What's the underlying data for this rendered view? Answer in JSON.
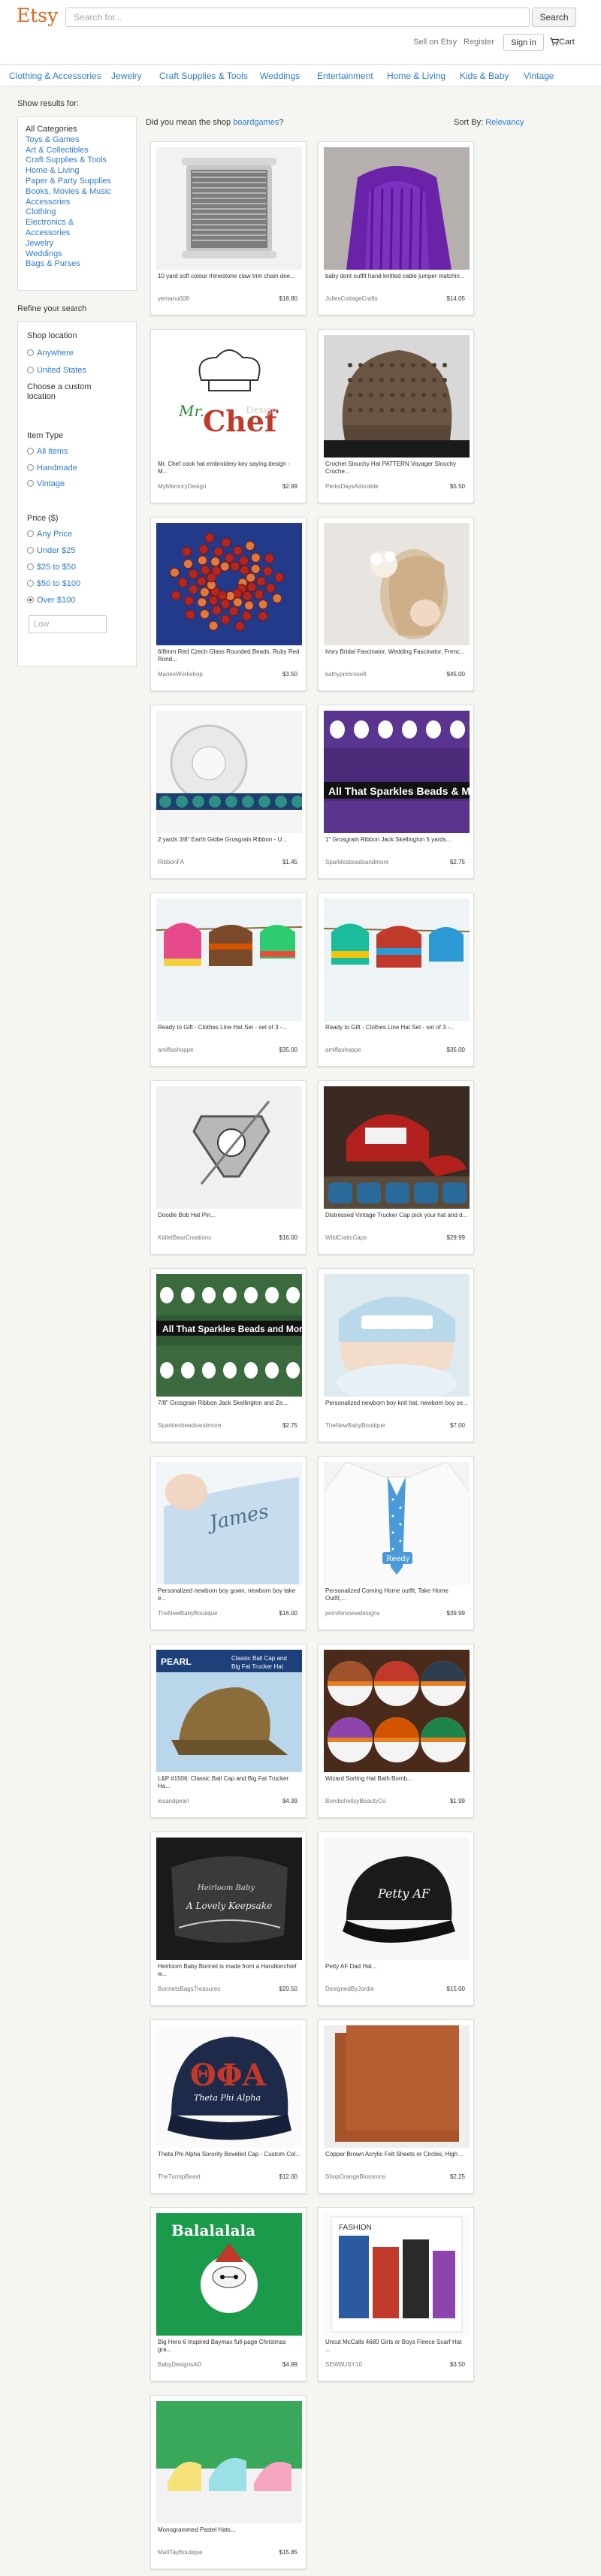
{
  "header": {
    "logo": "Etsy",
    "search_placeholder": "Search for...",
    "search_button": "Search",
    "sell": "Sell on Etsy",
    "register": "Register",
    "signin": "Sign in",
    "cart": "Cart"
  },
  "categories": [
    "Clothing & Accessories",
    "Jewelry",
    "Craft Supplies & Tools",
    "Weddings",
    "Entertainment",
    "Home & Living",
    "Kids & Baby",
    "Vintage"
  ],
  "sidebar": {
    "show_results": "Show results for:",
    "all_categories": "All Categories",
    "category_links": [
      "Toys & Games",
      "Art & Collectibles",
      "Craft Supplies & Tools",
      "Home & Living",
      "Paper & Party Supplies",
      "Books, Movies & Music",
      "Accessories",
      "Clothing",
      "Electronics &",
      "Accessories",
      "Jewelry",
      "Weddings",
      "Bags & Purses"
    ],
    "refine": "Refine your search",
    "shop_location": "Shop location",
    "location_options": [
      "Anywhere",
      "United States"
    ],
    "custom_location": "Choose a custom location",
    "item_type": "Item Type",
    "item_type_options": [
      "All items",
      "Handmade",
      "Vintage"
    ],
    "price": "Price ($)",
    "price_options": [
      "Any Price",
      "Under $25",
      "$25 to $50",
      "$50 to $100",
      "Over $100"
    ],
    "price_selected": "Over $100",
    "low_placeholder": "Low"
  },
  "main": {
    "did_you_mean_prefix": "Did you mean the shop",
    "did_you_mean_link": "boardgames",
    "did_you_mean_suffix": "?",
    "sort_label": "Sort By:",
    "sort_value": "Relevancy"
  },
  "listings": [
    {
      "title": "10 yard soft colour rhinestone claw trim chain dee...",
      "shop": "yemanu008",
      "price": "$18.80",
      "image": "rhinestone-chain-spool",
      "color": "#9a9a9a"
    },
    {
      "title": "baby dont outfit hand knitted cable jumper matchin...",
      "shop": "JuliesCottageCrafts",
      "price": "$14.05",
      "image": "purple-knit-sweater",
      "color": "#6a22a8"
    },
    {
      "title": "Mr. Chef cook hat embroidery key saying design - M...",
      "shop": "MyMemoryDesign",
      "price": "$2.99",
      "image": "chef-hat-embroidery",
      "color": "#c0392b"
    },
    {
      "title": "Crochet Slouchy Hat PATTERN Voyager Slouchy Croche...",
      "shop": "PerksDaysAdorable",
      "price": "$5.50",
      "image": "brown-slouchy-hat",
      "color": "#6b5643"
    },
    {
      "title": "6/8mm Red Czech Glass Rounded Beads, Ruby Red Rond...",
      "shop": "MariesWorkshop",
      "price": "$3.50",
      "image": "red-glass-beads",
      "color": "#b4261e"
    },
    {
      "title": "Ivory Bridal Fascinator, Wedding Fascinator, Frenc...",
      "shop": "kathyprimrose8",
      "price": "$45.00",
      "image": "bridal-fascinator",
      "color": "#d9c3a6"
    },
    {
      "title": "2 yards 3/8\" Earth Globe Grosgrain Ribbon - U...",
      "shop": "RibbonFA",
      "price": "$1.45",
      "image": "globe-ribbon",
      "color": "#2f8f84"
    },
    {
      "title": "1\" Grosgrain Ribbon Jack Skellington 5 yards...",
      "shop": "Sparklesbeadsandmore",
      "price": "$2.75",
      "image": "jack-skellington-ribbon",
      "color": "#4b2a7a"
    },
    {
      "title": "Ready to Gift - Clothes Line Hat Set - set of 3 -...",
      "shop": "amiflashoppe",
      "price": "$35.00",
      "image": "clothesline-hats",
      "color": "#e64a8a"
    },
    {
      "title": "Ready to Gift - Clothes Line Hat Set - set of 3 -...",
      "shop": "amiflashoppe",
      "price": "$35.00",
      "image": "clothesline-hats-2",
      "color": "#2d9ad6"
    },
    {
      "title": "Doodle Bob Hat Pin...",
      "shop": "KidletBearCreations",
      "price": "$16.00",
      "image": "hat-pin",
      "color": "#555555"
    },
    {
      "title": "Distressed Vintage Trucker Cap pick your hat and d...",
      "shop": "WildCraticCaps",
      "price": "$29.99",
      "image": "trucker-caps",
      "color": "#b3211e"
    },
    {
      "title": "7/8\" Grosgrain Ribbon Jack Skellington and Ze...",
      "shop": "Sparklesbeadsandmore",
      "price": "$2.75",
      "image": "jack-ribbon-green",
      "color": "#2f5a33"
    },
    {
      "title": "Personalized newborn boy knit hat, newborn boy se...",
      "shop": "TheNewBabyBoutique",
      "price": "$7.00",
      "image": "newborn-knit-hat",
      "color": "#b9d8ea"
    },
    {
      "title": "Personalized newborn boy gown, newborn boy take e...",
      "shop": "TheNewBabyBoutique",
      "price": "$16.00",
      "image": "newborn-gown",
      "color": "#c7dcec"
    },
    {
      "title": "Personalized Coming Home outfit, Take Home Outfit,...",
      "shop": "jennifersnewdesigns",
      "price": "$39.99",
      "image": "coming-home-outfit",
      "color": "#4a9ad9"
    },
    {
      "title": "L&P #1506: Classic Ball Cap and Big Fat Trucker Ha...",
      "shop": "lesandpearl",
      "price": "$4.99",
      "image": "ball-cap-pattern",
      "color": "#8a6d3b"
    },
    {
      "title": "Wizard Sorting Hat Bath Bomb...",
      "shop": "BombshellsyBeautyCo",
      "price": "$1.99",
      "image": "bath-bombs",
      "color": "#a0522d"
    },
    {
      "title": "Heirloom Baby Bonnet is made from a Handkerchief w...",
      "shop": "BonnetsBagsTreasures",
      "price": "$20.50",
      "image": "baby-bonnet",
      "color": "#222222"
    },
    {
      "title": "Petty AF Dad Hat...",
      "shop": "DesignedByJordie",
      "price": "$15.00",
      "image": "dad-hat",
      "color": "#1a1a1a"
    },
    {
      "title": "Theta Phi Alpha Sorority Beveled Cap - Custom Col...",
      "shop": "TheTurnipBeast",
      "price": "$12.00",
      "image": "sorority-cap",
      "color": "#1d2a4a"
    },
    {
      "title": "Copper Brown Acrylic Felt Sheets or Circles, High ...",
      "shop": "ShopOrangeBlossoms",
      "price": "$2.25",
      "image": "felt-sheets",
      "color": "#a8532a"
    },
    {
      "title": "Big Hero 6 Inspired Baymax full-page Christmas gra...",
      "shop": "BabyDesignsAD",
      "price": "$4.99",
      "image": "baymax-christmas",
      "color": "#1a9a4a"
    },
    {
      "title": "Uncut McCalls 4680 Girls or Boys Fleece Scarf Hat ...",
      "shop": "SEWBUSY10",
      "price": "$3.50",
      "image": "sewing-pattern",
      "color": "#2a2a2a"
    },
    {
      "title": "Monogrammed Pastel Hats...",
      "shop": "MattTayBoutique",
      "price": "$15.85",
      "image": "pastel-hats",
      "color": "#3aa85a"
    }
  ]
}
